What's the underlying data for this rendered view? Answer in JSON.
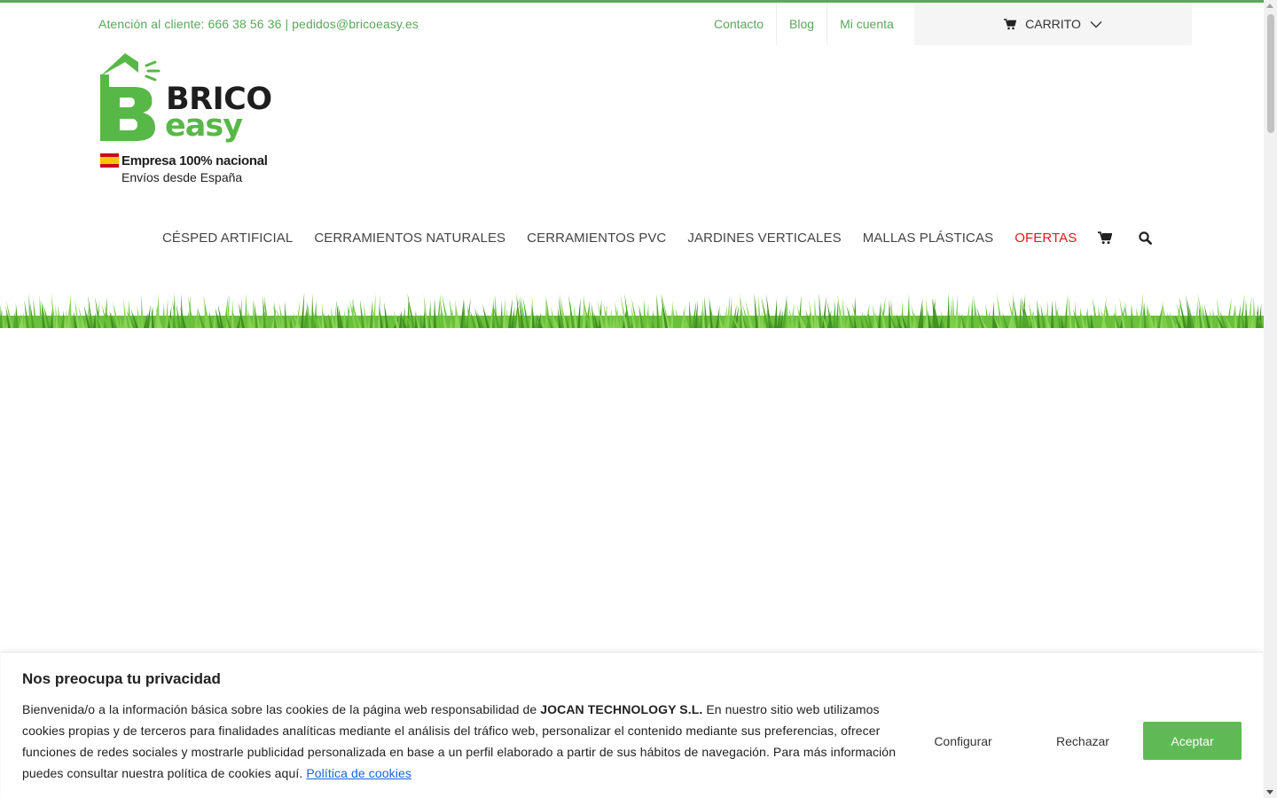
{
  "topbar": {
    "contact_info": "Atención al cliente: 666 38 56 36 | pedidos@bricoeasy.es",
    "links": [
      {
        "label": "Contacto"
      },
      {
        "label": "Blog"
      },
      {
        "label": "Mi cuenta"
      }
    ],
    "cart_label": "CARRITO",
    "accent_color": "#5aa85a"
  },
  "logo": {
    "brand_top": "BRICO",
    "brand_bottom": "easy",
    "tagline_1": "Empresa 100% nacional",
    "tagline_2": "Envíos desde España",
    "brand_green": "#58b847"
  },
  "nav": {
    "items": [
      {
        "label": "CÉSPED ARTIFICIAL"
      },
      {
        "label": "CERRAMIENTOS NATURALES"
      },
      {
        "label": "CERRAMIENTOS PVC"
      },
      {
        "label": "JARDINES VERTICALES"
      },
      {
        "label": "MALLAS PLÁSTICAS"
      },
      {
        "label": "OFERTAS"
      }
    ],
    "offer_color": "#e0161e",
    "icons": [
      "cart-icon",
      "search-icon"
    ]
  },
  "cookie_banner": {
    "title": "Nos preocupa tu privacidad",
    "text_before_company": "Bienvenida/o a la información básica sobre las cookies de la página web responsabilidad de ",
    "company": "JOCAN TECHNOLOGY S.L.",
    "text_after_company": " En nuestro sitio web utilizamos cookies propias y de terceros para finalidades analíticas mediante el análisis del tráfico web, personalizar el contenido mediante sus preferencias, ofrecer funciones de redes sociales y mostrarle publicidad personalizada en base a un perfil elaborado a partir de sus hábitos de navegación. Para más información puedes consultar nuestra política de cookies aquí. ",
    "policy_link": "Política de cookies",
    "buttons": {
      "configure": "Configurar",
      "reject": "Rechazar",
      "accept": "Aceptar"
    },
    "accept_color": "#5fba55"
  }
}
